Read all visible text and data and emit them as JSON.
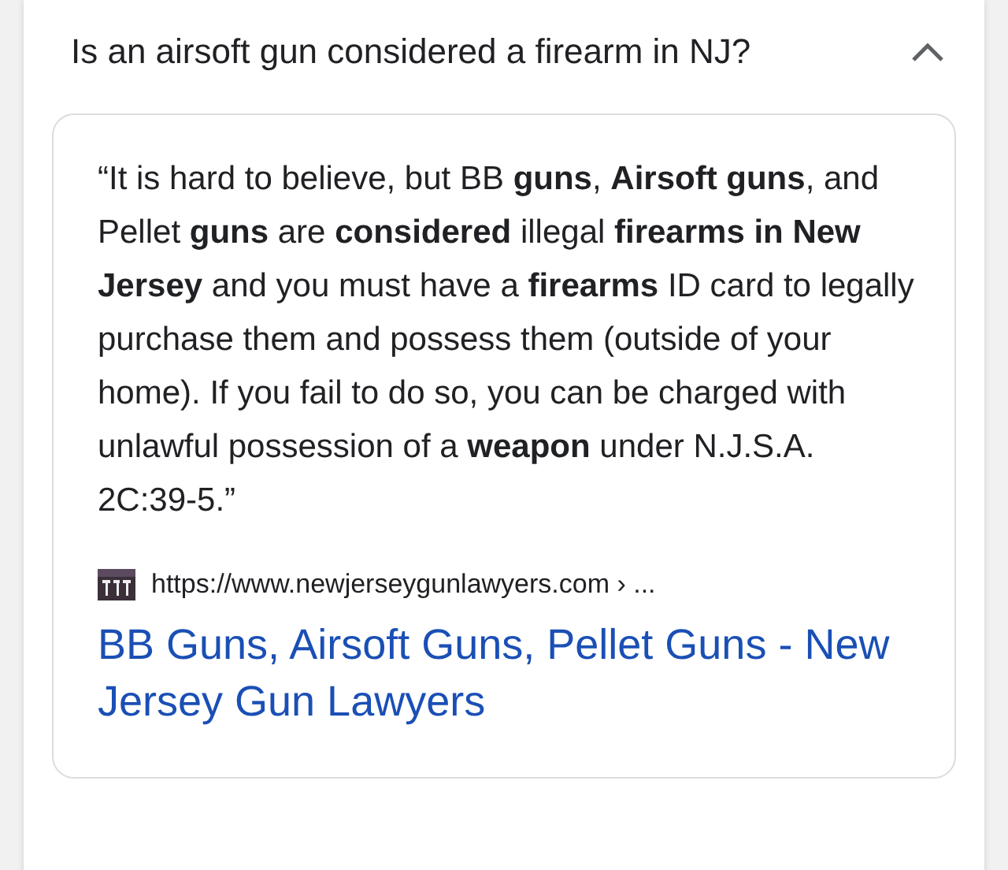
{
  "question": {
    "text": "Is an airsoft gun considered a firearm in NJ?",
    "expanded": true
  },
  "answer": {
    "snippet": "“It is hard to believe, but BB **guns**, **Airsoft guns**, and Pellet **guns** are **considered** illegal **firearms in New Jersey** and you must have a **firearms** ID card to legally purchase them and possess them (outside of your home). If you fail to do so, you can be charged with unlawful possession of a **weapon** under N.J.S.A. 2C:39-5.”",
    "source_url": "https://www.newjerseygunlawyers.com › ...",
    "link_title": "BB Guns, Airsoft Guns, Pellet Guns - New Jersey Gun Lawyers"
  }
}
